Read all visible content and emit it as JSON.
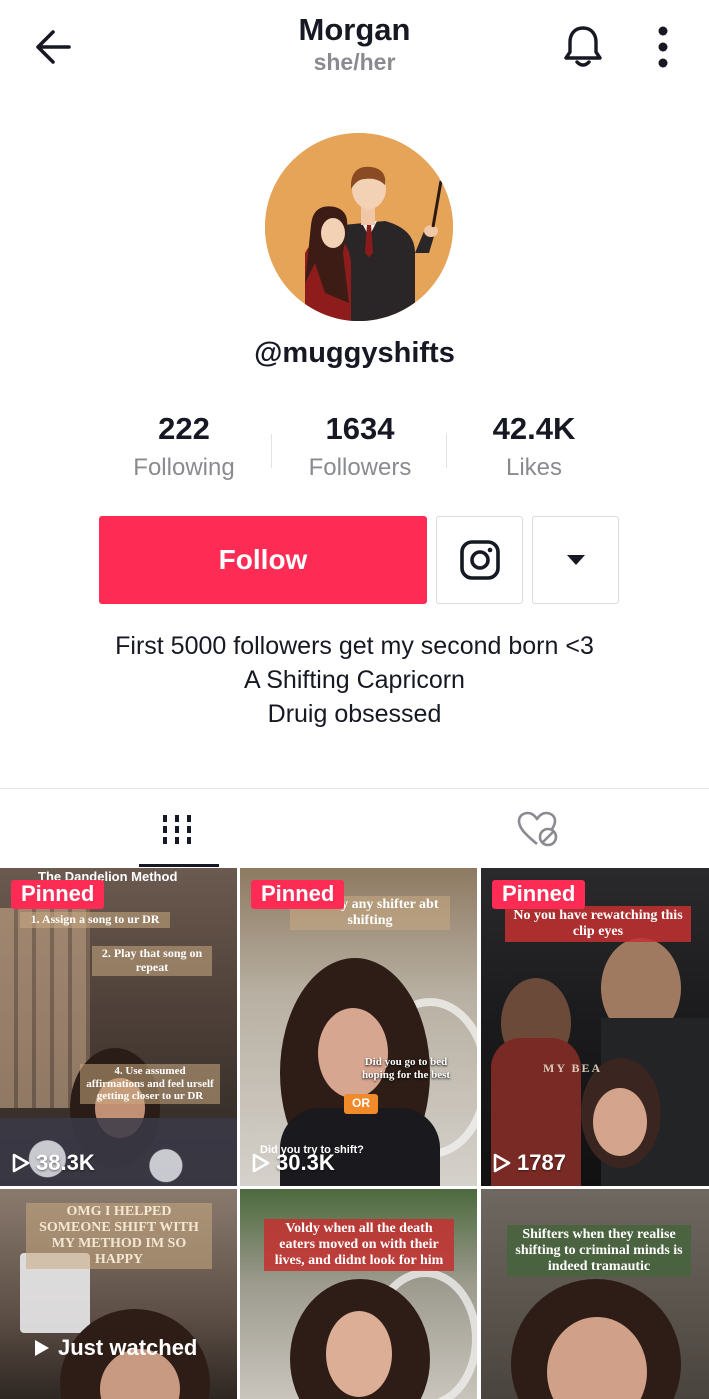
{
  "header": {
    "title": "Morgan",
    "pronouns": "she/her"
  },
  "profile": {
    "handle": "@muggyshifts",
    "stats": [
      {
        "value": "222",
        "label": "Following"
      },
      {
        "value": "1634",
        "label": "Followers"
      },
      {
        "value": "42.4K",
        "label": "Likes"
      }
    ],
    "follow_label": "Follow",
    "bio": [
      "First 5000 followers get my second born <3",
      "A Shifting Capricorn",
      "Druig obsessed"
    ]
  },
  "tabs": [
    {
      "icon": "videos-grid-icon",
      "active": true
    },
    {
      "icon": "liked-hidden-icon",
      "active": false
    }
  ],
  "videos": [
    {
      "pinned": "Pinned",
      "views": "38.3K",
      "title": "The Dandelion Method",
      "captions": [
        "1. Assign a song to ur DR",
        "2. Play that song on repeat",
        "4. Use assumed affirmations and feel urself getting closer to ur DR"
      ]
    },
    {
      "pinned": "Pinned",
      "views": "30.3K",
      "captions": [
        "literally any shifter abt shifting",
        "Did you go to bed hoping for the best",
        "OR",
        "Did you try to shift?"
      ]
    },
    {
      "pinned": "Pinned",
      "views": "1787",
      "captions": [
        "No you have rewatching this clip eyes"
      ]
    },
    {
      "overlay": "Just watched",
      "captions": [
        "OMG I HELPED SOMEONE SHIFT WITH MY METHOD IM SO HAPPY"
      ]
    },
    {
      "captions": [
        "Voldy when all the death eaters moved on with their lives, and didnt look for him"
      ]
    },
    {
      "captions": [
        "Shifters when they realise shifting to criminal minds is indeed tramautic"
      ]
    }
  ],
  "colors": {
    "accent": "#fe2c55",
    "text_primary": "#161823",
    "text_secondary": "#8a8b91"
  }
}
